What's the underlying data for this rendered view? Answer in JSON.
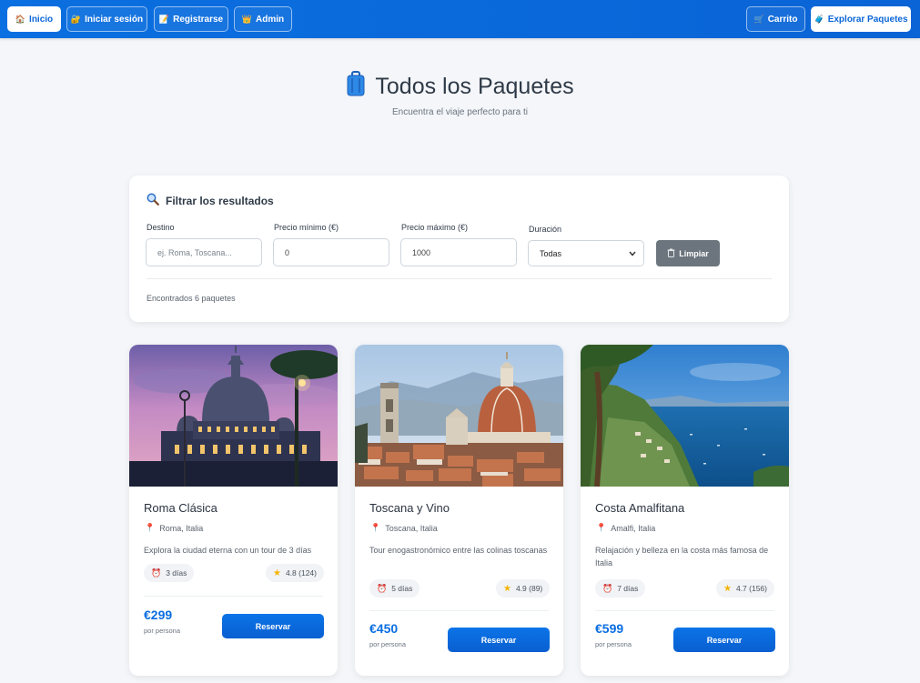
{
  "navbar": {
    "left": [
      {
        "label": "Inicio",
        "icon": "house-icon",
        "glyph": "🏠"
      },
      {
        "label": "Iniciar sesión",
        "icon": "key-icon",
        "glyph": "🔐"
      },
      {
        "label": "Registrarse",
        "icon": "memo-icon",
        "glyph": "📝"
      },
      {
        "label": "Admin",
        "icon": "crown-icon",
        "glyph": "👑"
      }
    ],
    "right": [
      {
        "label": "Carrito",
        "icon": "cart-icon",
        "glyph": "🛒"
      },
      {
        "label": "Explorar Paquetes",
        "icon": "luggage-icon",
        "glyph": "🧳"
      }
    ]
  },
  "hero": {
    "title": "Todos los Paquetes",
    "subtitle": "Encuentra el viaje perfecto para ti"
  },
  "filters": {
    "title": "Filtrar los resultados",
    "destination_label": "Destino",
    "destination_placeholder": "ej. Roma, Toscana...",
    "min_label": "Precio mínimo (€)",
    "min_value": "0",
    "max_label": "Precio máximo (€)",
    "max_value": "1000",
    "duration_label": "Duración",
    "duration_value": "Todas",
    "clear_label": "Limpiar",
    "count_text": "Encontrados 6 paquetes"
  },
  "packages": [
    {
      "name": "Roma Clásica",
      "location": "Roma, Italia",
      "description": "Explora la ciudad eterna con un tour de 3 días",
      "duration": "3 días",
      "rating": "4.8 (124)",
      "price": "€299",
      "per": "por persona",
      "button": "Reservar"
    },
    {
      "name": "Toscana y Vino",
      "location": "Toscana, Italia",
      "description": "Tour enogastronómico entre las colinas toscanas",
      "duration": "5 días",
      "rating": "4.9 (89)",
      "price": "€450",
      "per": "por persona",
      "button": "Reservar"
    },
    {
      "name": "Costa Amalfitana",
      "location": "Amalfi, Italia",
      "description": "Relajación y belleza en la costa más famosa de Italia",
      "duration": "7 días",
      "rating": "4.7 (156)",
      "price": "€599",
      "per": "por persona",
      "button": "Reservar"
    }
  ],
  "colors": {
    "nav": "#0a6fe0",
    "accent": "#0b6ee0",
    "clear": "#6c757d"
  }
}
